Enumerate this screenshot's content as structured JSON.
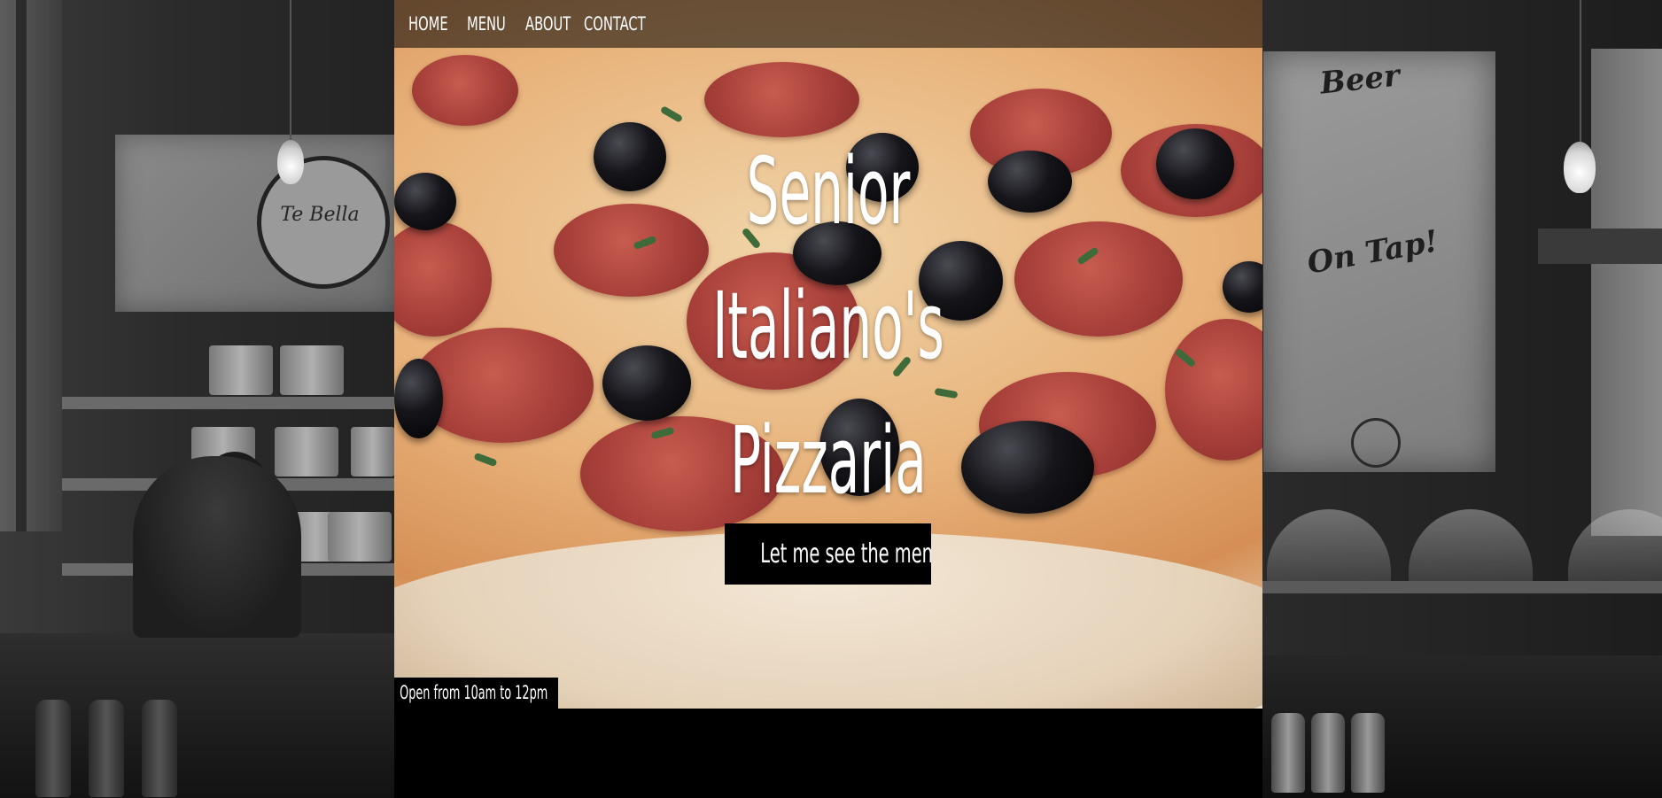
{
  "nav": {
    "items": [
      {
        "label": "HOME"
      },
      {
        "label": "MENU"
      },
      {
        "label": "ABOUT"
      },
      {
        "label": "CONTACT"
      }
    ]
  },
  "hero": {
    "title_lines": [
      "Senior",
      "Italiano's",
      "Pizzaria"
    ],
    "cta_label": "Let me see the menu",
    "hours": "Open from 10am to 12pm"
  },
  "background": {
    "sign_text": "Te Bella",
    "board_lines": [
      "Beer",
      "On Tap!"
    ]
  },
  "colors": {
    "nav_bar": "#000000",
    "cta_bg": "#000000",
    "text": "#ffffff",
    "page_bg": "#141414"
  }
}
